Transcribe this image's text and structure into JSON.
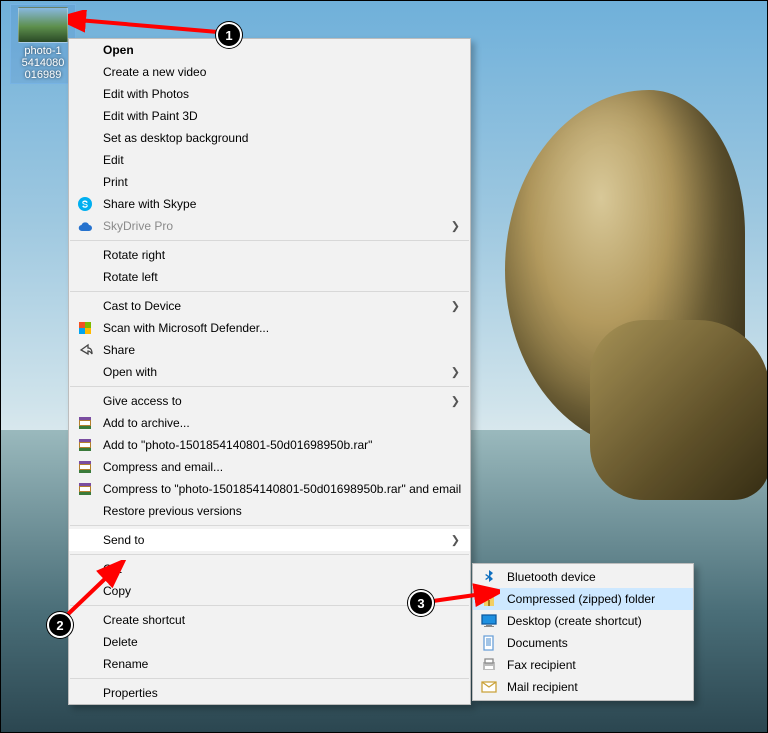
{
  "desktop_icon": {
    "label": "photo-1\n5414080\n016989"
  },
  "menu": [
    {
      "label": "Open",
      "bold": true
    },
    {
      "label": "Create a new video"
    },
    {
      "label": "Edit with Photos"
    },
    {
      "label": "Edit with Paint 3D"
    },
    {
      "label": "Set as desktop background"
    },
    {
      "label": "Edit"
    },
    {
      "label": "Print"
    },
    {
      "label": "Share with Skype",
      "icon": "skype-icon"
    },
    {
      "label": "SkyDrive Pro",
      "icon": "cloud-icon",
      "disabled": true,
      "submenu": true
    },
    {
      "sep": true
    },
    {
      "label": "Rotate right"
    },
    {
      "label": "Rotate left"
    },
    {
      "sep": true
    },
    {
      "label": "Cast to Device",
      "submenu": true
    },
    {
      "label": "Scan with Microsoft Defender...",
      "icon": "shield-icon"
    },
    {
      "label": "Share",
      "icon": "share-icon"
    },
    {
      "label": "Open with",
      "submenu": true
    },
    {
      "sep": true
    },
    {
      "label": "Give access to",
      "submenu": true
    },
    {
      "label": "Add to archive...",
      "icon": "rar-icon"
    },
    {
      "label": "Add to \"photo-1501854140801-50d01698950b.rar\"",
      "icon": "rar-icon"
    },
    {
      "label": "Compress and email...",
      "icon": "rar-icon"
    },
    {
      "label": "Compress to \"photo-1501854140801-50d01698950b.rar\" and email",
      "icon": "rar-icon"
    },
    {
      "label": "Restore previous versions"
    },
    {
      "sep": true
    },
    {
      "label": "Send to",
      "submenu": true,
      "hover": true
    },
    {
      "sep": true
    },
    {
      "label": "Cut"
    },
    {
      "label": "Copy"
    },
    {
      "sep": true
    },
    {
      "label": "Create shortcut"
    },
    {
      "label": "Delete"
    },
    {
      "label": "Rename"
    },
    {
      "sep": true
    },
    {
      "label": "Properties"
    }
  ],
  "submenu": [
    {
      "label": "Bluetooth device",
      "icon": "bluetooth-icon"
    },
    {
      "label": "Compressed (zipped) folder",
      "icon": "zip-icon",
      "hl": true
    },
    {
      "label": "Desktop (create shortcut)",
      "icon": "desktop-icon"
    },
    {
      "label": "Documents",
      "icon": "doc-icon"
    },
    {
      "label": "Fax recipient",
      "icon": "fax-icon"
    },
    {
      "label": "Mail recipient",
      "icon": "mail-icon"
    }
  ],
  "callouts": {
    "c1": "1",
    "c2": "2",
    "c3": "3"
  }
}
